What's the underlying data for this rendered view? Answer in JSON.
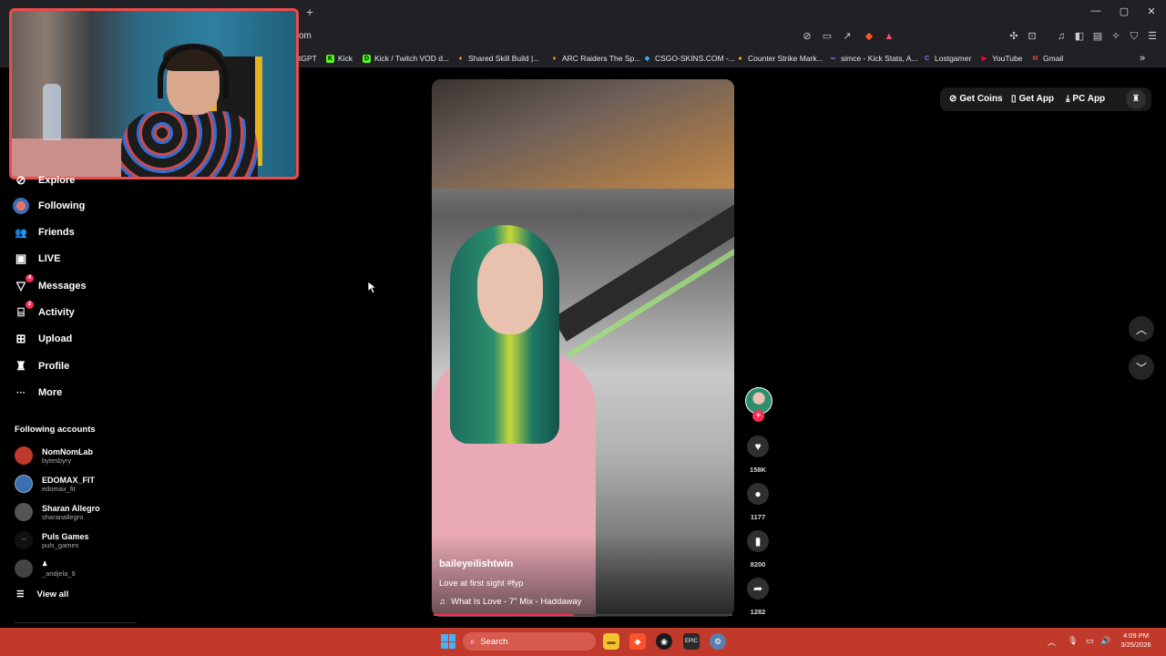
{
  "browser": {
    "new_tab": "+",
    "address_visible": "om",
    "window_controls": [
      "—",
      "▢",
      "✕"
    ],
    "bookmarks": [
      {
        "label": "tGPT",
        "fav": "",
        "color": "#202124"
      },
      {
        "label": "Kick",
        "fav": "K",
        "color": "#53fc18"
      },
      {
        "label": "Kick / Twitch VOD d...",
        "fav": "D",
        "color": "#53fc18"
      },
      {
        "label": "Shared Skill Build |...",
        "fav": "♦",
        "color": "#e8a33a"
      },
      {
        "label": "ARC Raiders The Sp...",
        "fav": "♦",
        "color": "#e8a33a"
      },
      {
        "label": "CSGO-SKINS.COM -...",
        "fav": "◆",
        "color": "#4aa3ff"
      },
      {
        "label": "Counter Strike Mark...",
        "fav": "●",
        "color": "#f2c230"
      },
      {
        "label": "simce - Kick Stats, A...",
        "fav": "∞",
        "color": "#7a8cff"
      },
      {
        "label": "Lostgamer",
        "fav": "C",
        "color": "#7b3cff"
      },
      {
        "label": "YouTube",
        "fav": "▶",
        "color": "#ff0033"
      },
      {
        "label": "Gmail",
        "fav": "M",
        "color": "#ea4335"
      }
    ]
  },
  "sidebar": {
    "items": [
      {
        "label": "Explore",
        "icon": "compass-icon",
        "glyph": "⊘",
        "badge": ""
      },
      {
        "label": "Following",
        "icon": "following-avatar-icon",
        "glyph": "",
        "badge": ""
      },
      {
        "label": "Friends",
        "icon": "friends-icon",
        "glyph": "👥",
        "badge": ""
      },
      {
        "label": "LIVE",
        "icon": "live-icon",
        "glyph": "▣",
        "badge": ""
      },
      {
        "label": "Messages",
        "icon": "messages-icon",
        "glyph": "▽",
        "badge": "4"
      },
      {
        "label": "Activity",
        "icon": "activity-icon",
        "glyph": "⌸",
        "badge": "2"
      },
      {
        "label": "Upload",
        "icon": "upload-icon",
        "glyph": "⊞",
        "badge": ""
      },
      {
        "label": "Profile",
        "icon": "profile-icon",
        "glyph": "♜",
        "badge": ""
      },
      {
        "label": "More",
        "icon": "more-icon",
        "glyph": "···",
        "badge": ""
      }
    ],
    "following_title": "Following accounts",
    "accounts": [
      {
        "name": "NomNomLab",
        "handle": "bytesbyry",
        "color": "#c0392b"
      },
      {
        "name": "EDOMAX_FIT",
        "handle": "edomax_fit",
        "color": "#3b6fb0"
      },
      {
        "name": "Sharan Allegro",
        "handle": "sharanallegro",
        "color": "#555555"
      },
      {
        "name": "Puls Games",
        "handle": "puls_games",
        "color": "#111111"
      },
      {
        "name": "",
        "handle": "_andjela_9",
        "color": "#444444"
      }
    ],
    "view_all": "View all"
  },
  "video": {
    "author": "baileyeilishtwin",
    "caption": "Love at first sight #fyp",
    "music": "What Is Love - 7\" Mix - Haddaway",
    "progress_fraction": 0.47
  },
  "actions": {
    "likes": "158K",
    "comments": "1177",
    "saves": "8200",
    "shares": "1282"
  },
  "top_right": {
    "get_coins": "Get Coins",
    "get_app": "Get App",
    "pc_app": "PC App"
  },
  "taskbar": {
    "search": "Search",
    "time": "4:09 PM",
    "date": "3/25/2026"
  },
  "colors": {
    "accent": "#fe2c55",
    "taskbar": "#c0392b",
    "webcam_border": "#ef4b4b"
  }
}
